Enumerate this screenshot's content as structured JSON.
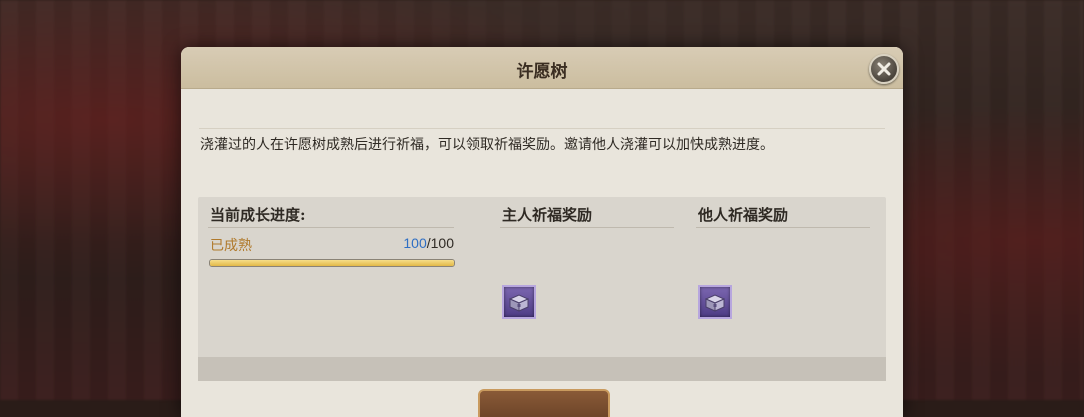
{
  "dialog": {
    "title": "许愿树",
    "description": "浇灌过的人在许愿树成熟后进行祈福，可以领取祈福奖励。邀请他人浇灌可以加快成熟进度。"
  },
  "growth": {
    "heading": "当前成长进度:",
    "status": "已成熟",
    "current": "100",
    "separator": "/",
    "max": "100",
    "fraction": 1.0
  },
  "rewards": {
    "owner_heading": "主人祈福奖励",
    "others_heading": "他人祈福奖励",
    "owner_items": [
      "treasure-chest-icon"
    ],
    "others_items": [
      "treasure-chest-icon"
    ]
  },
  "colors": {
    "progress_current": "#2f6fc4",
    "status_text": "#b07a2c",
    "progress_fill": "#e2b847"
  }
}
